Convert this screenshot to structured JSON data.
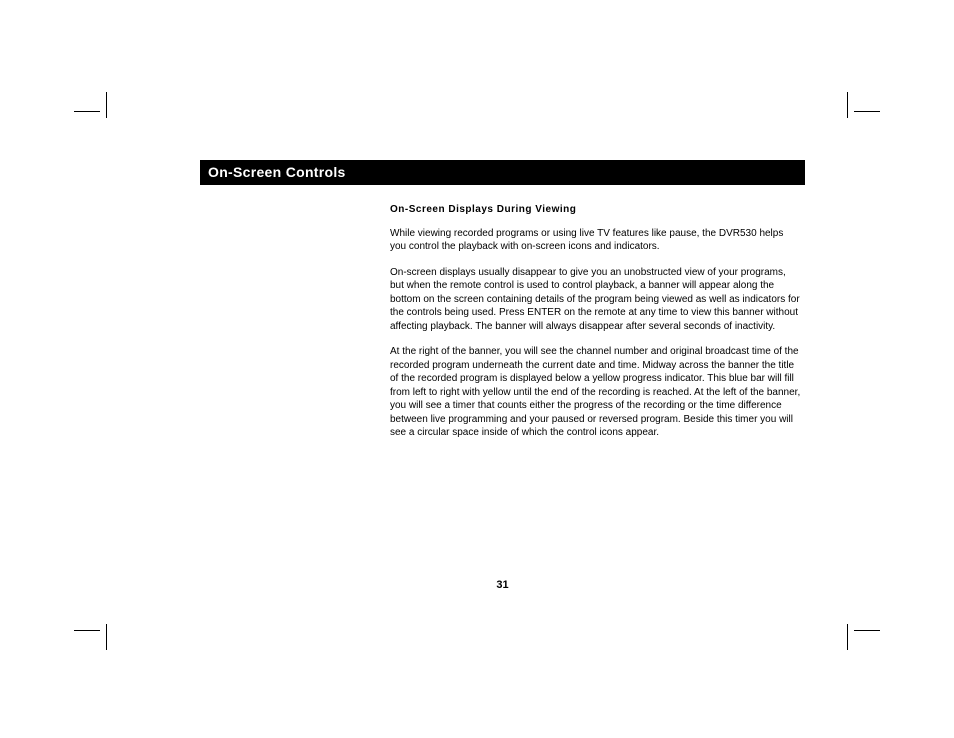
{
  "title_bar": "On-Screen Controls",
  "subhead": "On-Screen Displays During Viewing",
  "paragraphs": [
    "While viewing recorded programs or using live TV features like pause, the DVR530 helps you control the playback with on-screen icons and indicators.",
    "On-screen displays usually disappear to give you an unobstructed view of your programs, but when the remote control is used to control playback, a banner will appear along the bottom on the screen containing details of the program being viewed as well as indicators for the controls being used. Press ENTER on the remote at any time to view this banner without affecting playback. The banner will always disappear after several seconds of inactivity.",
    "At the right of the banner, you will see the channel number and original broadcast time of the recorded program underneath the current date and time. Midway across the banner the title of the recorded program is displayed below a yellow progress indicator. This blue bar will fill from left to right with yellow until the end of the recording is reached. At the left of the banner, you will see a timer that counts either the progress of the recording or the time difference between live programming and your paused or reversed program. Beside this timer you will see a circular space inside of which the control icons appear."
  ],
  "page_number": "31"
}
